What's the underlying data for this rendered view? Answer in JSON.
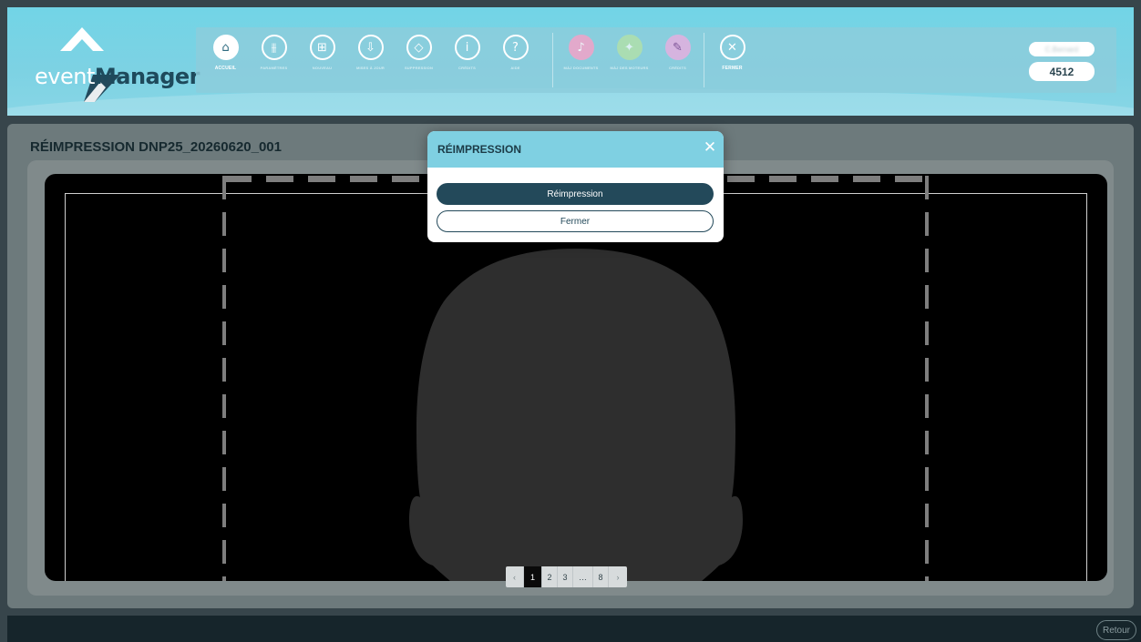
{
  "header": {
    "logo_event": "event",
    "logo_manager": "Manager",
    "user_name": "C.Bernard",
    "session_code": "4512"
  },
  "toolbar": {
    "items": [
      {
        "label": "Accueil",
        "icon": "home-icon"
      },
      {
        "label": "Paramètres",
        "icon": "sliders-icon"
      },
      {
        "label": "Nouveau",
        "icon": "plus-box-icon"
      },
      {
        "label": "Mises à jour",
        "icon": "download-tray-icon"
      },
      {
        "label": "Suppression",
        "icon": "eraser-icon"
      },
      {
        "label": "Crédits",
        "icon": "info-icon"
      },
      {
        "label": "Aide",
        "icon": "help-icon"
      },
      {
        "label": "MÀJ documents",
        "icon": "bell-icon"
      },
      {
        "label": "MÀJ des moteurs",
        "icon": "lightbulb-icon"
      },
      {
        "label": "Crédits",
        "icon": "signature-icon"
      },
      {
        "label": "Fermer",
        "icon": "close-circle-icon"
      }
    ]
  },
  "main": {
    "title": "RÉIMPRESSION DNP25_20260620_001"
  },
  "pagination": {
    "prev": "‹",
    "pages": [
      "1",
      "2",
      "3"
    ],
    "ellipsis": "…",
    "last": "8",
    "next": "›",
    "current": "1"
  },
  "modal": {
    "title": "RÉIMPRESSION",
    "primary_label": "Réimpression",
    "secondary_label": "Fermer"
  },
  "footer": {
    "back_label": "Retour"
  },
  "colors": {
    "header": "#72d4e6",
    "accent": "#23495a",
    "modal_header": "#7fd0e2"
  }
}
